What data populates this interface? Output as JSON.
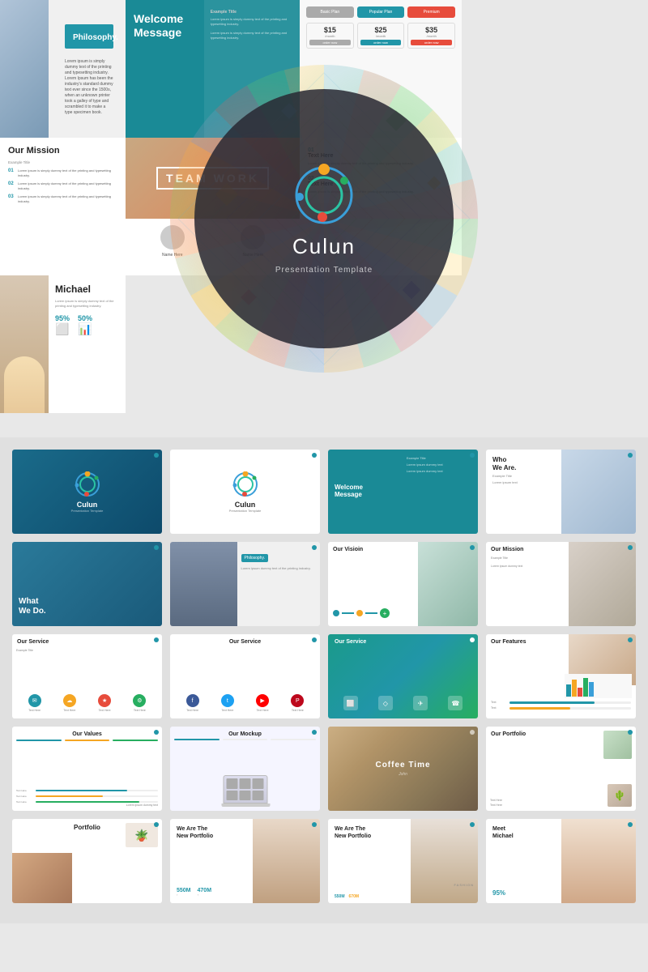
{
  "hero": {
    "brand_name": "Culun",
    "brand_subtitle": "Presentation Template",
    "slides": {
      "philosophy": {
        "title": "Philosophy.",
        "body_text": "Lorem ipsum is simply dummy text of the printing and typesetting industry. Lorem Ipsum has been the industry's standard dummy text ever since the 1500s, when an unknown printer took a galley of type and scrambled it to make a type specimen book."
      },
      "welcome": {
        "title": "Welcome Message",
        "example_title": "Example Title",
        "body_text": "Lorem ipsum is simply dummy text of the printing and typesetting industry."
      },
      "pricing": {
        "basic_label": "Basic Plan",
        "popular_label": "Popular Plan",
        "premium_label": "Premium",
        "basic_price": "$15",
        "popular_price": "$25",
        "premium_price": "$35",
        "period": "/month",
        "cta": "order now"
      },
      "mission": {
        "title": "Our Mission",
        "example_title": "Example Title",
        "items": [
          "Lorem ipsum is simply dummy text of the printing and typesetting industry.",
          "Lorem ipsum is simply dummy text of the printing and typesetting industry.",
          "Lorem ipsum is simply dummy text of the printing and typesetting industry."
        ]
      },
      "teamwork": {
        "label": "TEAM WORK",
        "person1": "Name Here",
        "person2": "Name Here"
      },
      "michael": {
        "name": "Michael",
        "body_text": "Lorem ipsum is simply dummy text of the printing and typesetting industry.",
        "stat1": "95%",
        "stat2": "50%"
      }
    }
  },
  "grid": {
    "row1": [
      {
        "id": "culun-cover",
        "type": "culun-cover",
        "label": "Culun",
        "sub": "Presentation Template"
      },
      {
        "id": "culun-white",
        "type": "culun-white",
        "label": "Culun",
        "sub": "Presentation Template"
      },
      {
        "id": "welcome-msg",
        "type": "welcome-msg",
        "label": "Welcome Message"
      },
      {
        "id": "who-we-are",
        "type": "who-we-are",
        "label": "Who We Are.",
        "sub": "Example Title"
      }
    ],
    "row2": [
      {
        "id": "what-we-do",
        "type": "what-we-do",
        "label": "What We Do."
      },
      {
        "id": "philosophy",
        "type": "philosophy",
        "label": "Philosophy."
      },
      {
        "id": "our-vision",
        "type": "our-vision",
        "label": "Our Visioin"
      },
      {
        "id": "our-mission",
        "type": "our-mission",
        "label": "Our Mission"
      }
    ],
    "row3": [
      {
        "id": "our-service-1",
        "type": "our-service-1",
        "label": "Our Service"
      },
      {
        "id": "our-service-2",
        "type": "our-service-2",
        "label": "Our Service"
      },
      {
        "id": "our-service-3",
        "type": "our-service-3",
        "label": "Our Service"
      },
      {
        "id": "our-features",
        "type": "our-features",
        "label": "Our Features"
      }
    ],
    "row4": [
      {
        "id": "our-values",
        "type": "our-values",
        "label": "Our Values"
      },
      {
        "id": "our-mockup",
        "type": "our-mockup",
        "label": "Our Mockup"
      },
      {
        "id": "coffee-time",
        "type": "coffee-time",
        "label": "Coffee Time"
      },
      {
        "id": "our-portfolio",
        "type": "our-portfolio",
        "label": "Our Portfolio"
      }
    ],
    "row5": [
      {
        "id": "portfolio2",
        "type": "portfolio2",
        "label": "Portfolio"
      },
      {
        "id": "new-portfolio",
        "type": "new-portfolio",
        "title_line1": "We Are The",
        "title_line2": "New Portfolio",
        "stat1_val": "550M",
        "stat1_label": "",
        "stat2_val": "470M",
        "stat2_label": ""
      },
      {
        "id": "new-portfolio2",
        "type": "new-portfolio2",
        "title_line1": "We Are The",
        "title_line2": "New Portfolio",
        "fashion": "FASHION"
      },
      {
        "id": "meet-michael",
        "type": "meet-michael",
        "title_line1": "Meet",
        "title_line2": "Michael",
        "pct": "95%"
      }
    ]
  },
  "colors": {
    "teal": "#2196a8",
    "teal_dark": "#1a8a96",
    "accent_orange": "#f5a623",
    "accent_red": "#e74c3c",
    "accent_green": "#27ae60",
    "accent_blue": "#3a9fd9"
  }
}
